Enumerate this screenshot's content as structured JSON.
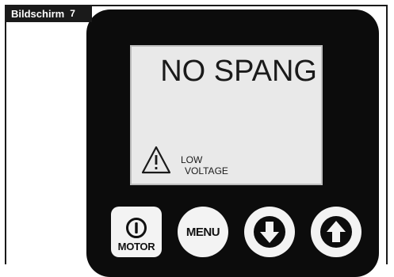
{
  "caption": {
    "label": "Bildschirm",
    "number": "7"
  },
  "display": {
    "message": "NO SPANG",
    "warning_line1": "LOW",
    "warning_line2": "VOLTAGE",
    "warning_icon": "warning-triangle-icon"
  },
  "buttons": {
    "motor": {
      "label": "MOTOR",
      "icon": "power-icon"
    },
    "menu": {
      "label": "MENU"
    },
    "down": {
      "icon": "arrow-down-icon"
    },
    "up": {
      "icon": "arrow-up-icon"
    }
  },
  "colors": {
    "panel": "#0c0c0c",
    "screen": "#e9e9e9",
    "button": "#f3f3f3"
  }
}
